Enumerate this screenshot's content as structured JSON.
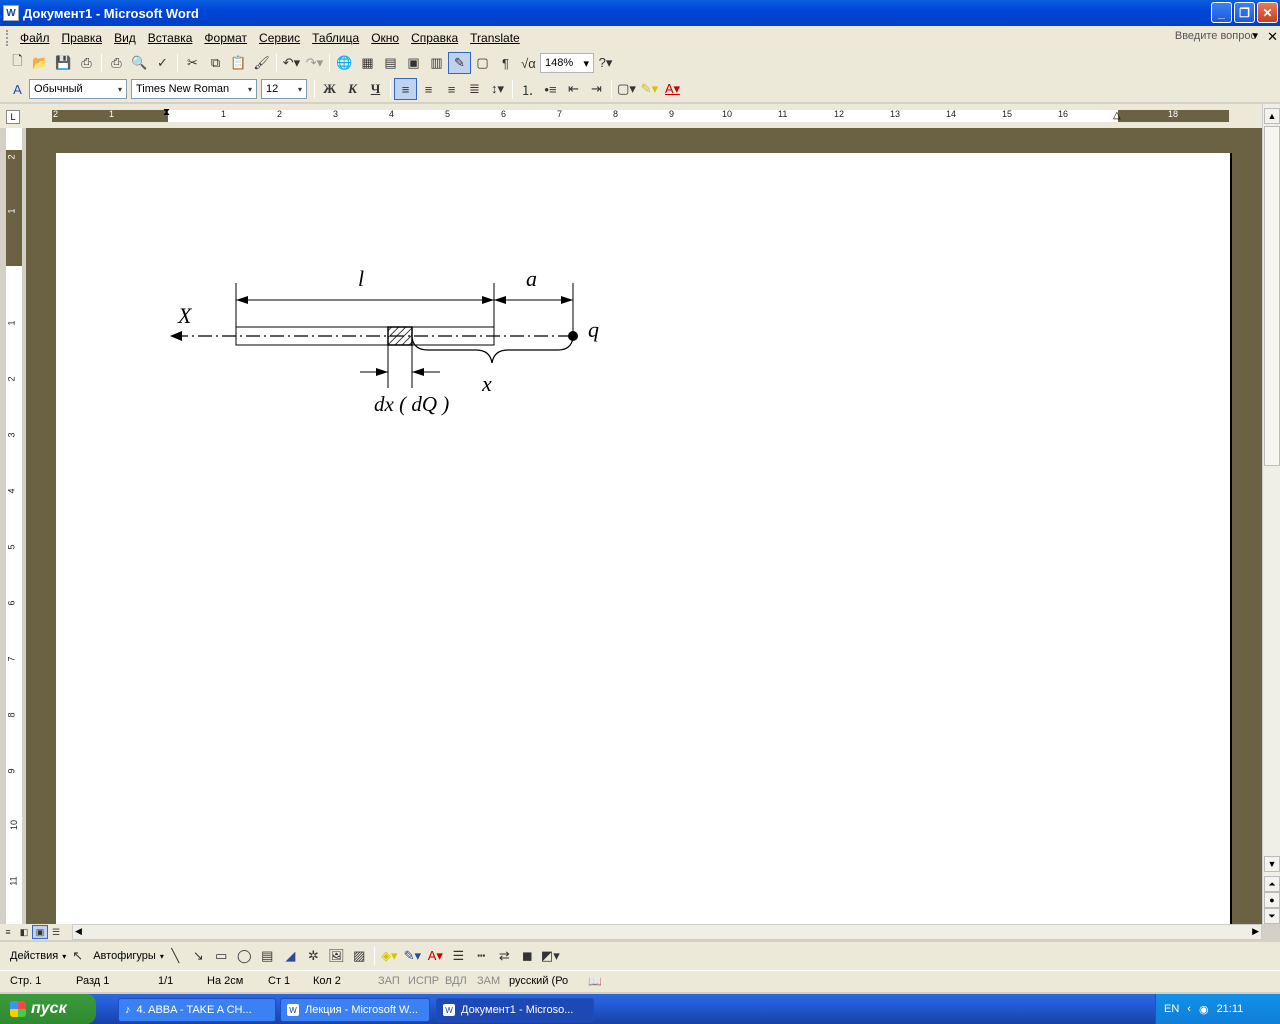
{
  "window": {
    "title": "Документ1 - Microsoft Word"
  },
  "menu": {
    "items": [
      "Файл",
      "Правка",
      "Вид",
      "Вставка",
      "Формат",
      "Сервис",
      "Таблица",
      "Окно",
      "Справка",
      "Translate"
    ],
    "ask_placeholder": "Введите вопрос"
  },
  "toolbar": {
    "zoom": "148%"
  },
  "format_bar": {
    "style": "Обычный",
    "font": "Times New Roman",
    "size": "12",
    "bold_label": "Ж",
    "italic_label": "К",
    "underline_label": "Ч"
  },
  "ruler": {
    "numbers": [
      "2",
      "1",
      "1",
      "2",
      "3",
      "4",
      "5",
      "6",
      "7",
      "8",
      "9",
      "10",
      "11",
      "12",
      "13",
      "14",
      "15",
      "16",
      "18"
    ]
  },
  "vruler": {
    "numbers": [
      "2",
      "1",
      "1",
      "2",
      "3",
      "4",
      "5",
      "6",
      "7",
      "8",
      "9",
      "10",
      "11"
    ]
  },
  "figure": {
    "label_l": "l",
    "label_a": "a",
    "label_X": "X",
    "label_q": "q",
    "label_x": "x",
    "label_dx": "dx ( dQ )"
  },
  "drawbar": {
    "actions": "Действия",
    "autoshapes": "Автофигуры"
  },
  "status": {
    "page": "Стр. 1",
    "section": "Разд 1",
    "pages": "1/1",
    "at": "На 2см",
    "line": "Ст 1",
    "col": "Кол 2",
    "rec": "ЗАП",
    "trk": "ИСПР",
    "ext": "ВДЛ",
    "ovr": "ЗАМ",
    "lang": "русский (Ро"
  },
  "taskbar": {
    "start": "пуск",
    "tasks": [
      "4. ABBA - TAKE A CH...",
      "Лекция - Microsoft W...",
      "Документ1 - Microso..."
    ],
    "lang": "EN",
    "time": "21:11"
  }
}
